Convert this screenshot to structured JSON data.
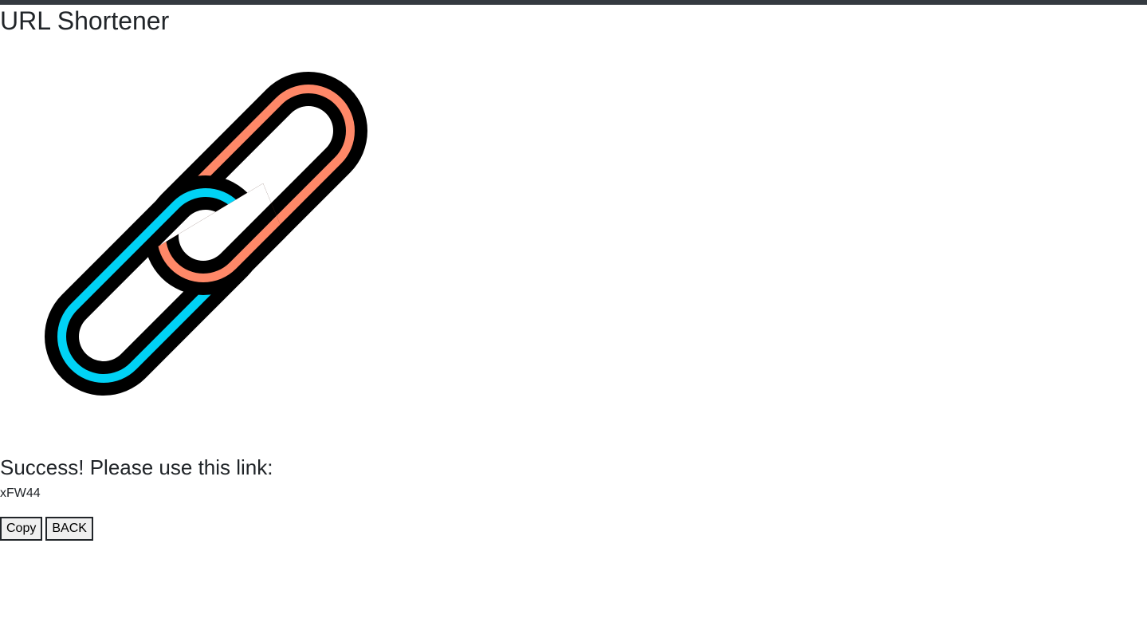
{
  "header": {
    "title": "URL Shortener"
  },
  "logo": {
    "icon": "chain-link-icon",
    "colors": {
      "back_link": "#ff8868",
      "front_link": "#00d2f5",
      "outline": "#000000"
    }
  },
  "result": {
    "heading": "Success! Please use this link:",
    "short_code": "xFW44"
  },
  "actions": {
    "copy_label": "Copy",
    "back_label": "BACK"
  }
}
